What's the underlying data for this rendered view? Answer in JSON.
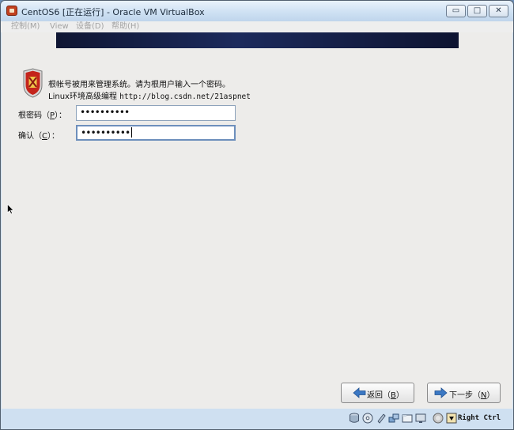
{
  "window": {
    "title": "CentOS6 [正在运行] - Oracle VM VirtualBox",
    "controls": {
      "minimize": "▭",
      "maximize": "□",
      "close": "✕"
    }
  },
  "menu": {
    "items": [
      {
        "label": "控制(M)"
      },
      {
        "label": "View"
      },
      {
        "label": "设备(D)"
      },
      {
        "label": "帮助(H)"
      }
    ]
  },
  "installer": {
    "info_line1": "根帐号被用来管理系统。请为根用户输入一个密码。",
    "info_line2_text": "Linux环境高级编程 ",
    "info_line2_url": "http://blog.csdn.net/21aspnet",
    "root_password": {
      "label_prefix": "根密码（",
      "label_key": "P",
      "label_suffix": "）：",
      "value": "••••••••••"
    },
    "confirm_password": {
      "label_prefix": "确认（",
      "label_key": "C",
      "label_suffix": "）：",
      "value": "••••••••••"
    },
    "back_button": {
      "prefix": "返回（",
      "key": "B",
      "suffix": "）"
    },
    "next_button": {
      "prefix": "下一步（",
      "key": "N",
      "suffix": "）"
    }
  },
  "statusbar": {
    "icons": [
      "hard-disk-icon",
      "optical-drive-icon",
      "usb-icon",
      "network-icon",
      "shared-folders-icon",
      "display-icon",
      "mouse-integration-icon",
      "capture-arrow-icon"
    ],
    "host_key": "Right Ctrl"
  },
  "colors": {
    "banner": "#1c2a5c",
    "frame": "#cfe0f1",
    "guest_bg": "#edecea"
  }
}
